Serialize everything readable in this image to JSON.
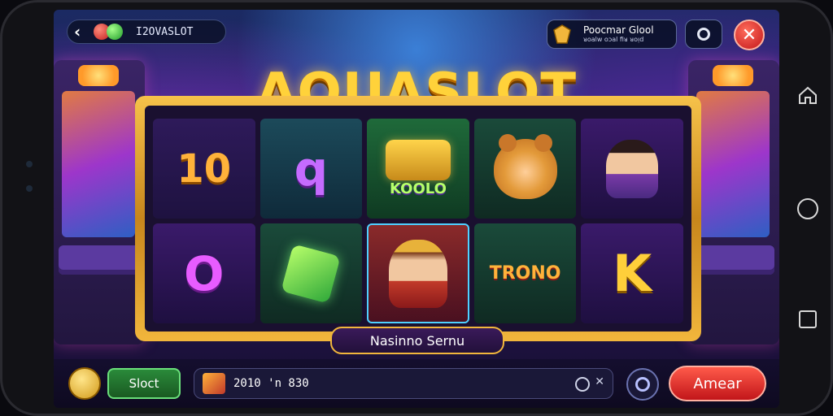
{
  "app": {
    "name_small": "I2OVASLOT",
    "title": "AQUASLOT"
  },
  "header": {
    "back_icon": "chevron-left-icon",
    "promo": {
      "title": "Poocmar Glool",
      "subtitle": "ᴚoalw oɔal fiᴚ ᴚoᴉd"
    },
    "settings_icon": "settings-icon",
    "close_icon": "close-icon",
    "close_glyph": "✕",
    "back_glyph": "‹"
  },
  "reels": {
    "top": [
      {
        "symbol": "10",
        "bg": "purple"
      },
      {
        "symbol": "q",
        "bg": "teal"
      },
      {
        "symbol": "KOOLO",
        "bg": "green"
      },
      {
        "symbol": "bear",
        "bg": "darkgreen"
      },
      {
        "symbol": "person",
        "bg": "violet"
      }
    ],
    "bottom": [
      {
        "symbol": "O",
        "bg": "violet"
      },
      {
        "symbol": "glass",
        "bg": "darkgreen"
      },
      {
        "symbol": "queen",
        "bg": "red"
      },
      {
        "symbol": "TRONO",
        "bg": "darkgreen"
      },
      {
        "symbol": "K",
        "bg": "violet"
      }
    ]
  },
  "plaque": {
    "label": "Nasinno Sernu"
  },
  "bottombar": {
    "slot_label": "Sloct",
    "field_value": "2010 'n 830",
    "field_clear": "✕",
    "play_label": "Amear"
  },
  "colors": {
    "accent_gold": "#f1b63c",
    "play_red": "#c2161a",
    "slot_green": "#2a8a3a"
  }
}
